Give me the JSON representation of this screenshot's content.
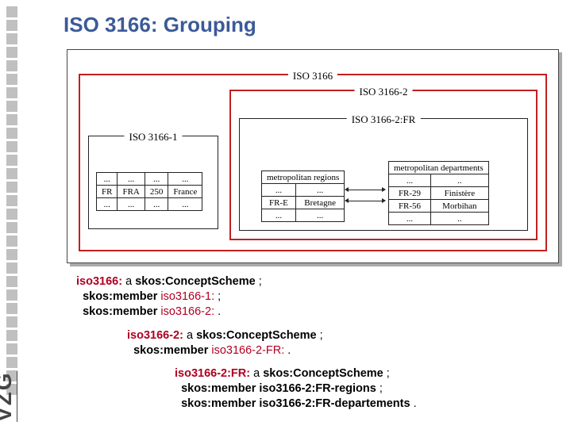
{
  "title": "ISO 3166: Grouping",
  "vzg": "VZG",
  "diagram": {
    "outer": "ISO 3166",
    "part1": "ISO 3166-1",
    "part2": "ISO 3166-2",
    "part2fr": "ISO 3166-2:FR",
    "tbl1": {
      "rows": [
        [
          "...",
          "...",
          "...",
          "..."
        ],
        [
          "FR",
          "FRA",
          "250",
          "France"
        ],
        [
          "...",
          "...",
          "...",
          "..."
        ]
      ]
    },
    "tbl2": {
      "title": "metropolitan regions",
      "rows": [
        [
          "...",
          "..."
        ],
        [
          "FR-E",
          "Bretagne"
        ],
        [
          "...",
          "..."
        ]
      ]
    },
    "tbl3": {
      "title": "metropolitan departments",
      "rows": [
        [
          "...",
          ".."
        ],
        [
          "FR-29",
          "Finistère"
        ],
        [
          "FR-56",
          "Morbihan"
        ],
        [
          "...",
          ".."
        ]
      ]
    }
  },
  "rdf": {
    "b1": {
      "s": "iso3166:",
      "a": "a",
      "t": "skos:ConceptScheme",
      "m1": "skos:member",
      "o1": "iso3166-1:",
      "m2": "skos:member",
      "o2": "iso3166-2:"
    },
    "b2": {
      "s": "iso3166-2:",
      "a": "a",
      "t": "skos:ConceptScheme",
      "m1": "skos:member",
      "o1": "iso3166-2-FR:"
    },
    "b3": {
      "s": "iso3166-2:FR:",
      "a": "a",
      "t": "skos:ConceptScheme",
      "m1": "skos:member iso3166-2:FR-regions",
      "m2": "skos:member iso3166-2:FR-departements"
    }
  }
}
